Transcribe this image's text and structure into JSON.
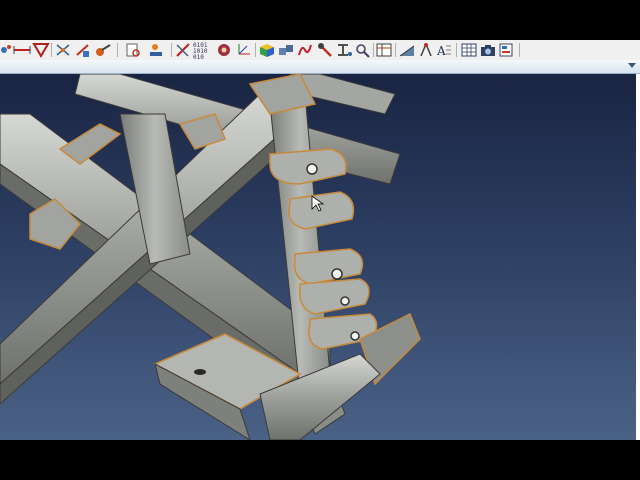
{
  "window": {
    "letterbox_color": "#000000"
  },
  "toolbar": {
    "buttons": [
      {
        "name": "node-tools-icon",
        "icon": "node-tools-icon",
        "kind": "tool"
      },
      {
        "name": "measure-distance-icon",
        "icon": "measure-distance-icon",
        "kind": "tool"
      },
      {
        "name": "filter-funnel-icon",
        "icon": "filter-funnel-icon",
        "kind": "tool"
      },
      {
        "name": "mesh-edit-icon",
        "icon": "mesh-edit-icon",
        "kind": "tool"
      },
      {
        "name": "vector-add-icon",
        "icon": "vector-add-icon",
        "kind": "tool"
      },
      {
        "name": "weld-torch-icon",
        "icon": "weld-torch-icon",
        "kind": "tool"
      },
      {
        "name": "document-search-icon",
        "icon": "document-search-icon",
        "kind": "tool"
      },
      {
        "name": "connector-icon",
        "icon": "connector-icon",
        "kind": "tool"
      },
      {
        "name": "pencil-ruler-icon",
        "icon": "pencil-ruler-icon",
        "kind": "tool"
      },
      {
        "name": "binary-data-icon",
        "icon": "binary-data-icon",
        "kind": "tool",
        "text": "0101\n1010\n010"
      },
      {
        "name": "gear-spring-icon",
        "icon": "gear-spring-icon",
        "kind": "tool"
      },
      {
        "name": "axis-xyz-icon",
        "icon": "axis-xyz-icon",
        "kind": "tool"
      },
      {
        "name": "color-cube-icon",
        "icon": "color-cube-icon",
        "kind": "tool"
      },
      {
        "name": "multi-cube-icon",
        "icon": "multi-cube-icon",
        "kind": "tool"
      },
      {
        "name": "spring-coil-icon",
        "icon": "spring-coil-icon",
        "kind": "tool"
      },
      {
        "name": "bolt-icon",
        "icon": "bolt-icon",
        "kind": "tool"
      },
      {
        "name": "beam-section-icon",
        "icon": "beam-section-icon",
        "kind": "tool"
      },
      {
        "name": "zoom-check-icon",
        "icon": "zoom-check-icon",
        "kind": "tool"
      },
      {
        "name": "table-grid-icon",
        "icon": "table-grid-icon",
        "kind": "tool"
      },
      {
        "name": "signal-ramp-icon",
        "icon": "signal-ramp-icon",
        "kind": "tool"
      },
      {
        "name": "compass-tool-icon",
        "icon": "compass-tool-icon",
        "kind": "tool"
      },
      {
        "name": "text-annotation-icon",
        "icon": "text-annotation-icon",
        "kind": "tool"
      },
      {
        "name": "spreadsheet-icon",
        "icon": "spreadsheet-icon",
        "kind": "tool"
      },
      {
        "name": "camera-icon",
        "icon": "camera-icon",
        "kind": "tool"
      },
      {
        "name": "properties-panel-icon",
        "icon": "properties-panel-icon",
        "kind": "tool"
      }
    ]
  },
  "viewport": {
    "content": "3d-frame-assembly-model",
    "background_top": "#1a2442",
    "background_bottom": "#4a6286",
    "part_color": "#9c9e9b",
    "edge_color": "#c88a3a"
  }
}
